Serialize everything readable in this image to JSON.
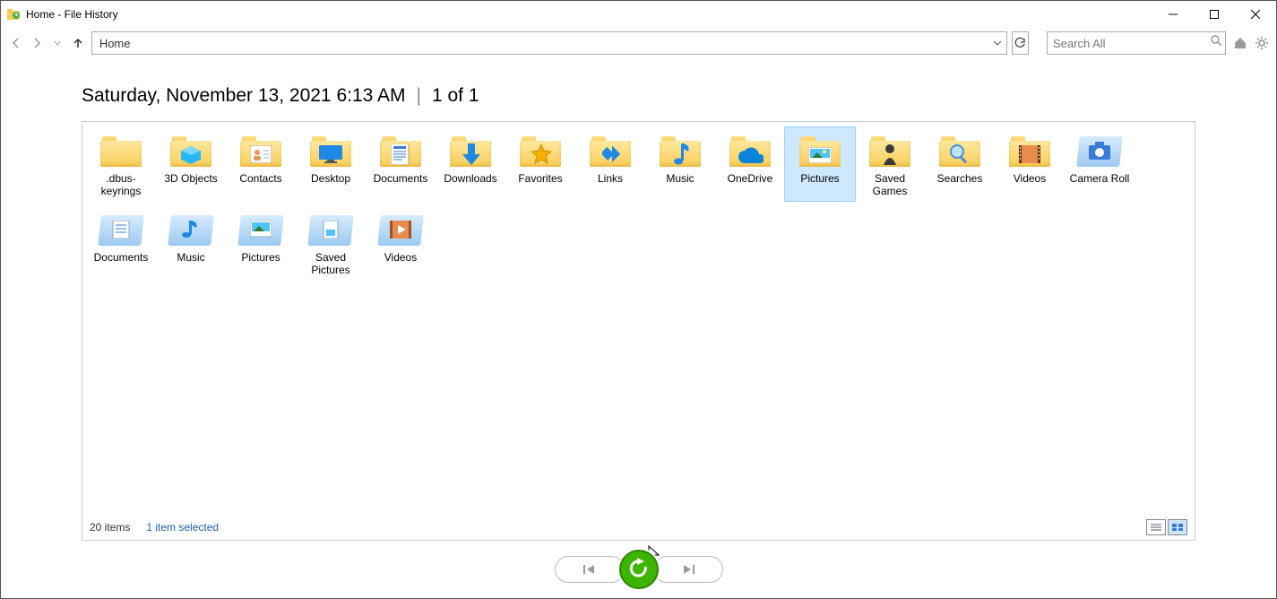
{
  "title": "Home - File History",
  "address": "Home",
  "search_placeholder": "Search All",
  "date": "Saturday, November 13, 2021 6:13 AM",
  "pages": "1 of 1",
  "status": {
    "count": "20 items",
    "selected": "1 item selected"
  },
  "items": [
    {
      "label": ".dbus-keyrings",
      "icon": "folder",
      "selected": false
    },
    {
      "label": "3D Objects",
      "icon": "folder-3d",
      "selected": false
    },
    {
      "label": "Contacts",
      "icon": "folder-contacts",
      "selected": false
    },
    {
      "label": "Desktop",
      "icon": "folder-desktop",
      "selected": false
    },
    {
      "label": "Documents",
      "icon": "folder-documents",
      "selected": false
    },
    {
      "label": "Downloads",
      "icon": "folder-downloads",
      "selected": false
    },
    {
      "label": "Favorites",
      "icon": "folder-favorites",
      "selected": false
    },
    {
      "label": "Links",
      "icon": "folder-links",
      "selected": false
    },
    {
      "label": "Music",
      "icon": "folder-music",
      "selected": false
    },
    {
      "label": "OneDrive",
      "icon": "folder-onedrive",
      "selected": false
    },
    {
      "label": "Pictures",
      "icon": "folder-pictures",
      "selected": true
    },
    {
      "label": "Saved Games",
      "icon": "folder-games",
      "selected": false
    },
    {
      "label": "Searches",
      "icon": "folder-search",
      "selected": false
    },
    {
      "label": "Videos",
      "icon": "folder-videos",
      "selected": false
    },
    {
      "label": "Camera Roll",
      "icon": "lib-camera",
      "selected": false
    },
    {
      "label": "Documents",
      "icon": "lib-documents",
      "selected": false
    },
    {
      "label": "Music",
      "icon": "lib-music",
      "selected": false
    },
    {
      "label": "Pictures",
      "icon": "lib-pictures",
      "selected": false
    },
    {
      "label": "Saved Pictures",
      "icon": "lib-saved",
      "selected": false
    },
    {
      "label": "Videos",
      "icon": "lib-videos",
      "selected": false
    }
  ]
}
